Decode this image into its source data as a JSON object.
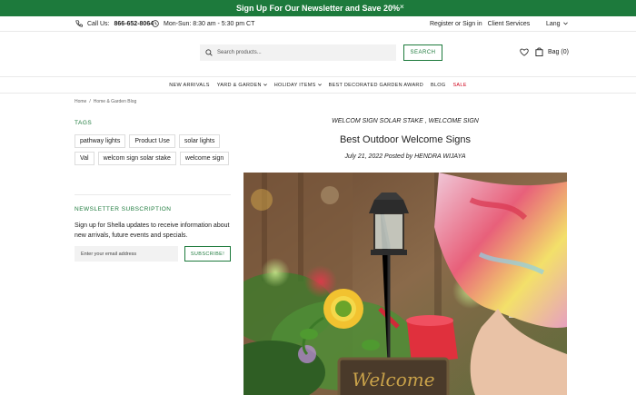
{
  "promo": {
    "text": "Sign Up For Our Newsletter and Save 20%",
    "close": "×"
  },
  "topbar": {
    "call_label": "Call Us:",
    "phone": "866-652-8064",
    "hours": "Mon-Sun: 8:30 am - 5:30 pm CT",
    "register": "Register or Sign in",
    "client_services": "Client Services",
    "lang": "Lang"
  },
  "header": {
    "search_placeholder": "Search products...",
    "search_button": "SEARCH",
    "bag": "Bag (0)"
  },
  "nav": {
    "items": [
      "NEW ARRIVALS",
      "YARD & GARDEN",
      "HOLIDAY ITEMS",
      "BEST DECORATED GARDEN AWARD",
      "BLOG",
      "SALE"
    ]
  },
  "breadcrumb": {
    "home": "Home",
    "sep": "/",
    "current": "Home & Garden Blog"
  },
  "sidebar": {
    "tags_title": "TAGS",
    "tags": [
      "pathway lights",
      "Product Use",
      "solar lights",
      "Val",
      "welcom sign solar stake",
      "welcome sign"
    ],
    "newsletter_title": "NEWSLETTER SUBSCRIPTION",
    "newsletter_text": "Sign up for Shella updates to receive information about new arrivals, future events and specials.",
    "email_placeholder": "Enter your email address",
    "subscribe": "SUBSCRIBE!"
  },
  "post": {
    "tags_line": "WELCOM SIGN SOLAR STAKE , WELCOME SIGN",
    "title": "Best Outdoor Welcome Signs",
    "meta": "July 21, 2022 Posted by HENDRA WIJAYA",
    "image_sign_text": "Welcome"
  },
  "colors": {
    "brand_green": "#1d7a3c",
    "sale_red": "#d0021b"
  },
  "icons": [
    "phone-icon",
    "clock-icon",
    "chevron-down-icon",
    "search-icon",
    "heart-icon",
    "bag-icon"
  ]
}
